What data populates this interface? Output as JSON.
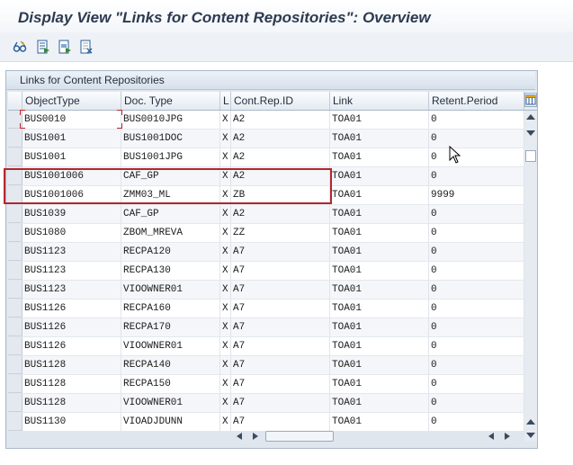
{
  "window": {
    "title": "Display View \"Links for Content Repositories\": Overview"
  },
  "toolbar": {
    "icons": [
      "glasses-icon",
      "select-all-icon",
      "select-block-icon",
      "deselect-all-icon"
    ]
  },
  "panel": {
    "title": "Links for Content Repositories"
  },
  "table": {
    "columns": [
      "ObjectType",
      "Doc. Type",
      "L",
      "Cont.Rep.ID",
      "Link",
      "Retent.Period"
    ],
    "rows": [
      {
        "object_type": "BUS0010",
        "doc_type": "BUS0010JPG",
        "l": "X",
        "cont_rep_id": "A2",
        "link": "TOA01",
        "retent_period": "0"
      },
      {
        "object_type": "BUS1001",
        "doc_type": "BUS1001DOC",
        "l": "X",
        "cont_rep_id": "A2",
        "link": "TOA01",
        "retent_period": "0"
      },
      {
        "object_type": "BUS1001",
        "doc_type": "BUS1001JPG",
        "l": "X",
        "cont_rep_id": "A2",
        "link": "TOA01",
        "retent_period": "0"
      },
      {
        "object_type": "BUS1001006",
        "doc_type": "CAF_GP",
        "l": "X",
        "cont_rep_id": "A2",
        "link": "TOA01",
        "retent_period": "0"
      },
      {
        "object_type": "BUS1001006",
        "doc_type": "ZMM03_ML",
        "l": "X",
        "cont_rep_id": "ZB",
        "link": "TOA01",
        "retent_period": "9999"
      },
      {
        "object_type": "BUS1039",
        "doc_type": "CAF_GP",
        "l": "X",
        "cont_rep_id": "A2",
        "link": "TOA01",
        "retent_period": "0"
      },
      {
        "object_type": "BUS1080",
        "doc_type": "ZBOM_MREVA",
        "l": "X",
        "cont_rep_id": "ZZ",
        "link": "TOA01",
        "retent_period": "0"
      },
      {
        "object_type": "BUS1123",
        "doc_type": "RECPA120",
        "l": "X",
        "cont_rep_id": "A7",
        "link": "TOA01",
        "retent_period": "0"
      },
      {
        "object_type": "BUS1123",
        "doc_type": "RECPA130",
        "l": "X",
        "cont_rep_id": "A7",
        "link": "TOA01",
        "retent_period": "0"
      },
      {
        "object_type": "BUS1123",
        "doc_type": "VIOOWNER01",
        "l": "X",
        "cont_rep_id": "A7",
        "link": "TOA01",
        "retent_period": "0"
      },
      {
        "object_type": "BUS1126",
        "doc_type": "RECPA160",
        "l": "X",
        "cont_rep_id": "A7",
        "link": "TOA01",
        "retent_period": "0"
      },
      {
        "object_type": "BUS1126",
        "doc_type": "RECPA170",
        "l": "X",
        "cont_rep_id": "A7",
        "link": "TOA01",
        "retent_period": "0"
      },
      {
        "object_type": "BUS1126",
        "doc_type": "VIOOWNER01",
        "l": "X",
        "cont_rep_id": "A7",
        "link": "TOA01",
        "retent_period": "0"
      },
      {
        "object_type": "BUS1128",
        "doc_type": "RECPA140",
        "l": "X",
        "cont_rep_id": "A7",
        "link": "TOA01",
        "retent_period": "0"
      },
      {
        "object_type": "BUS1128",
        "doc_type": "RECPA150",
        "l": "X",
        "cont_rep_id": "A7",
        "link": "TOA01",
        "retent_period": "0"
      },
      {
        "object_type": "BUS1128",
        "doc_type": "VIOOWNER01",
        "l": "X",
        "cont_rep_id": "A7",
        "link": "TOA01",
        "retent_period": "0"
      },
      {
        "object_type": "BUS1130",
        "doc_type": "VIOADJDUNN",
        "l": "X",
        "cont_rep_id": "A7",
        "link": "TOA01",
        "retent_period": "0"
      }
    ]
  },
  "colors": {
    "highlight_box": "#b3272d",
    "title_text": "#2c3b4f",
    "panel_bg": "#dfe6ee"
  }
}
